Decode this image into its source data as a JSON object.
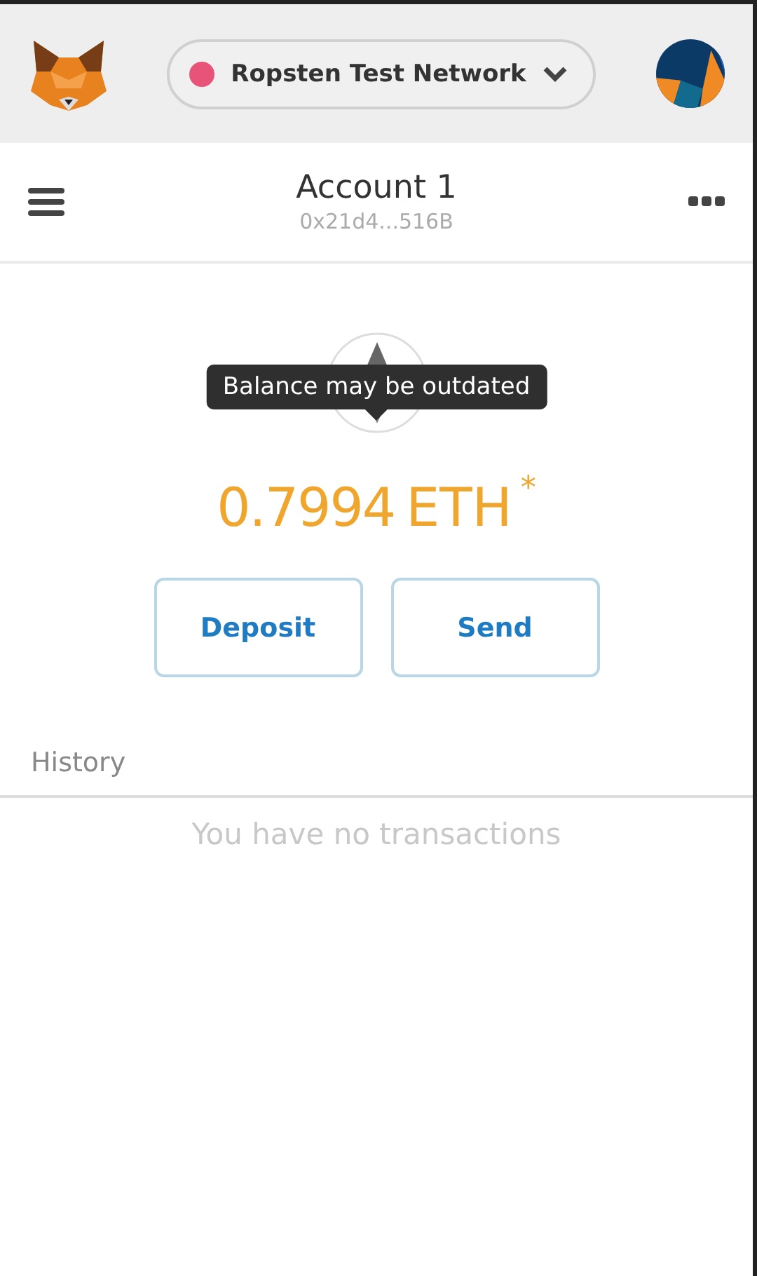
{
  "network": {
    "label": "Ropsten Test Network"
  },
  "account": {
    "name": "Account 1",
    "address": "0x21d4...516B"
  },
  "tooltip": {
    "text": "Balance may be outdated"
  },
  "balance": {
    "amount": "0.7994",
    "unit": "ETH",
    "mark": "*"
  },
  "buttons": [
    {
      "label": "Deposit"
    },
    {
      "label": "Send"
    }
  ],
  "history": {
    "title": "History",
    "empty": "You have no transactions"
  }
}
